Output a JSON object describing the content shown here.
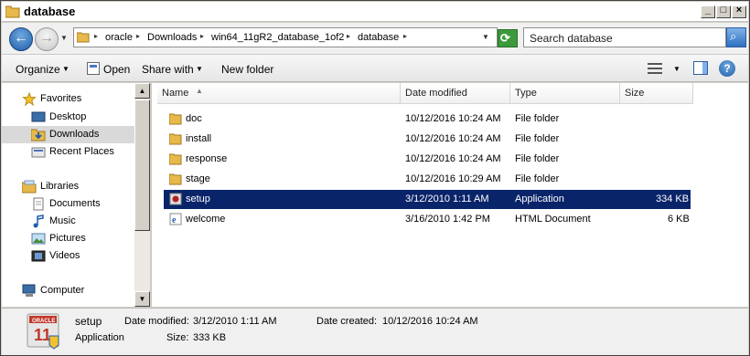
{
  "window": {
    "title": "database"
  },
  "address": {
    "crumbs": [
      "oracle",
      "Downloads",
      "win64_11gR2_database_1of2",
      "database"
    ],
    "search_placeholder": "Search database"
  },
  "toolbar": {
    "organize": "Organize",
    "open": "Open",
    "share_with": "Share with",
    "new_folder": "New folder"
  },
  "nav": {
    "favorites": "Favorites",
    "desktop": "Desktop",
    "downloads": "Downloads",
    "recent_places": "Recent Places",
    "libraries": "Libraries",
    "documents": "Documents",
    "music": "Music",
    "pictures": "Pictures",
    "videos": "Videos",
    "computer": "Computer"
  },
  "columns": {
    "name": "Name",
    "date_modified": "Date modified",
    "type": "Type",
    "size": "Size"
  },
  "files": [
    {
      "name": "doc",
      "date": "10/12/2016 10:24 AM",
      "type": "File folder",
      "size": ""
    },
    {
      "name": "install",
      "date": "10/12/2016 10:24 AM",
      "type": "File folder",
      "size": ""
    },
    {
      "name": "response",
      "date": "10/12/2016 10:24 AM",
      "type": "File folder",
      "size": ""
    },
    {
      "name": "stage",
      "date": "10/12/2016 10:29 AM",
      "type": "File folder",
      "size": ""
    },
    {
      "name": "setup",
      "date": "3/12/2010 1:11 AM",
      "type": "Application",
      "size": "334 KB"
    },
    {
      "name": "welcome",
      "date": "3/16/2010 1:42 PM",
      "type": "HTML Document",
      "size": "6 KB"
    }
  ],
  "details": {
    "name": "setup",
    "type": "Application",
    "date_modified_label": "Date modified:",
    "date_modified": "3/12/2010 1:11 AM",
    "date_created_label": "Date created:",
    "date_created": "10/12/2016 10:24 AM",
    "size_label": "Size:",
    "size": "333 KB",
    "icon_brand": "ORACLE",
    "icon_version": "11"
  },
  "colors": {
    "selection": "#0a246a",
    "folder": "#e8b94a"
  }
}
